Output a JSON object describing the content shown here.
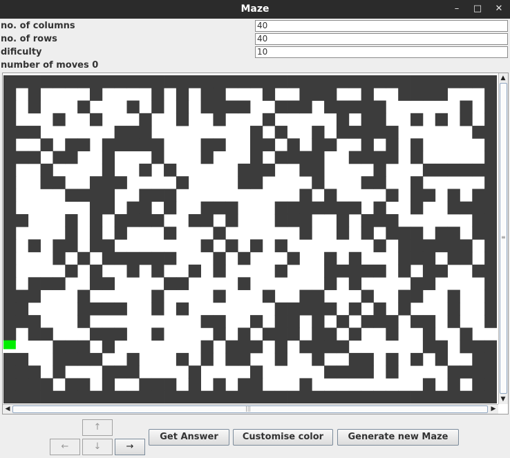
{
  "window": {
    "title": "Maze",
    "minimize_glyph": "–",
    "maximize_glyph": "□",
    "close_glyph": "✕"
  },
  "form": {
    "columns_label": "no. of columns",
    "columns_value": "40",
    "rows_label": "no. of rows",
    "rows_value": "40",
    "difficulty_label": "dificulty",
    "difficulty_value": "10",
    "moves_label": "number of moves 0"
  },
  "maze": {
    "columns": 40,
    "rows": 26,
    "wall_color": "#3c3c3c",
    "path_color": "#ffffff",
    "player_color": "#00ee00",
    "player_cell": {
      "col": 0,
      "row": 21
    },
    "exit_cell": {
      "col": 39,
      "row": 20
    }
  },
  "scrollbars": {
    "up_arrow": "▲",
    "down_arrow": "▼",
    "left_arrow": "◀",
    "right_arrow": "▶",
    "grip_vertical": "≡",
    "grip_horizontal": "|||"
  },
  "controls": {
    "up_label": "↑",
    "left_label": "←",
    "down_label": "↓",
    "right_label": "→",
    "get_answer_label": "Get Answer",
    "customise_color_label": "Customise color",
    "generate_label": "Generate new Maze"
  }
}
